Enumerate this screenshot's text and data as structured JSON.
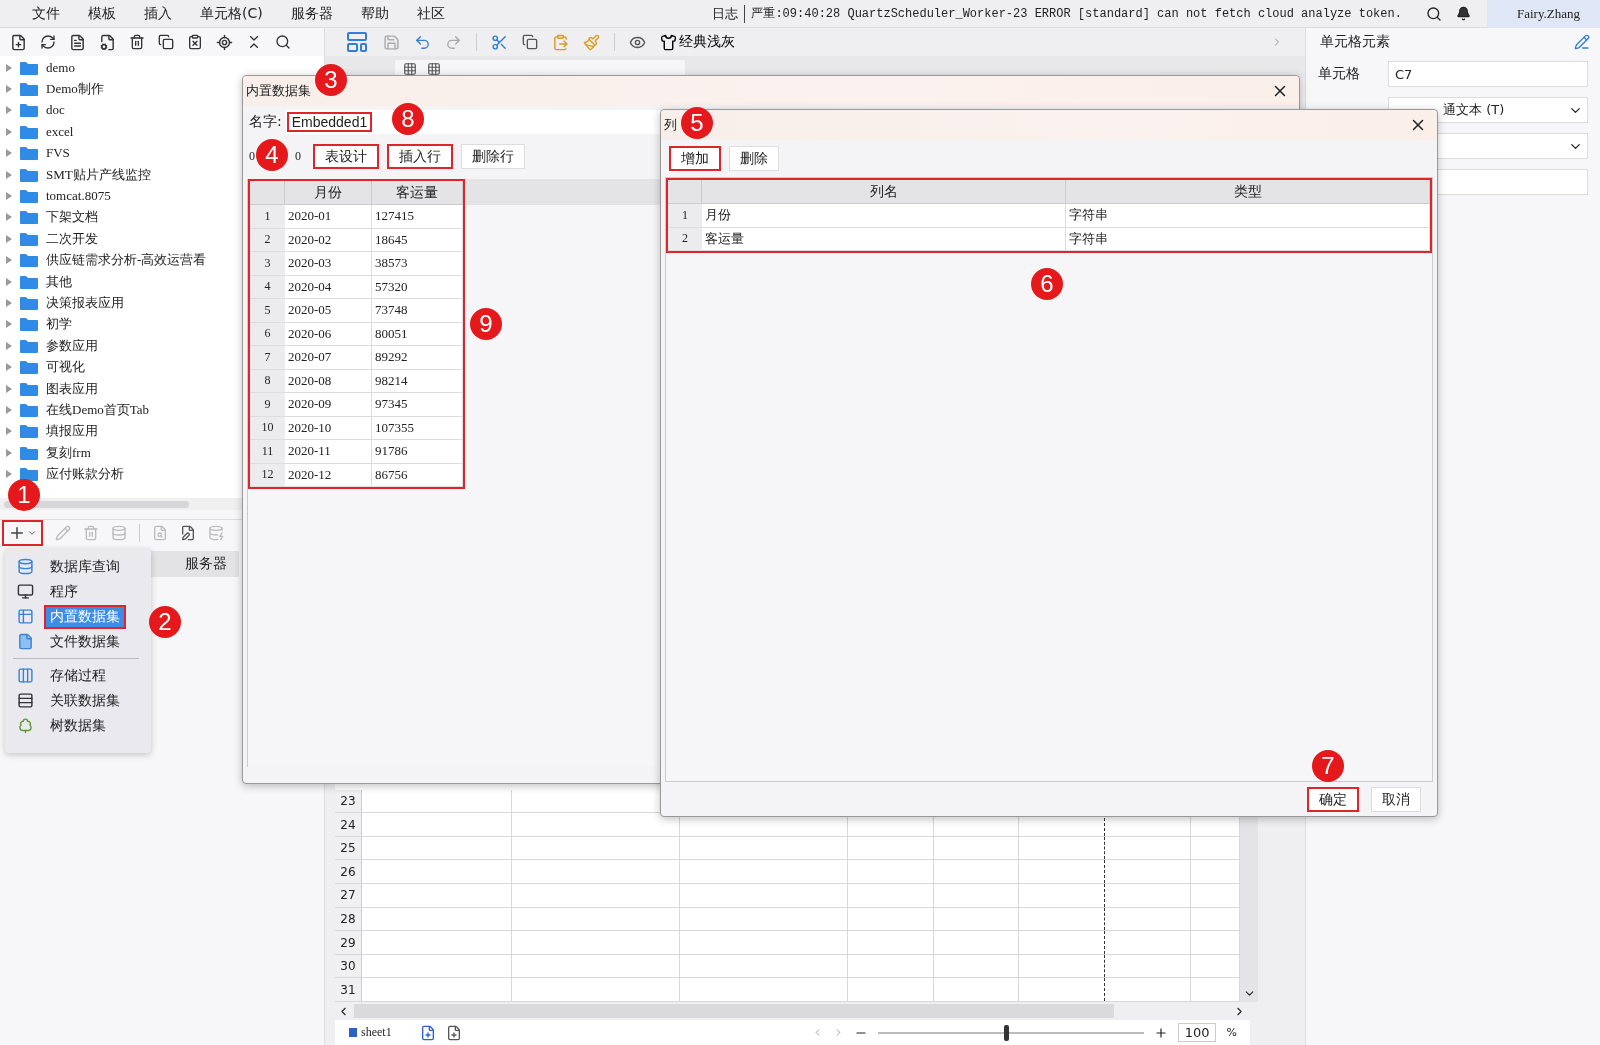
{
  "menu_bar": {
    "menus": [
      "文件",
      "模板",
      "插入",
      "单元格(C)",
      "服务器",
      "帮助",
      "社区"
    ],
    "log_label": "日志",
    "log_message": "严重:09:40:28 QuartzScheduler_Worker-23 ERROR [standard] can not fetch cloud analyze token.",
    "user": "Fairy.Zhang"
  },
  "center_toolbar": {
    "style_button": "经典浅灰"
  },
  "template_tree": {
    "items": [
      {
        "label": "demo"
      },
      {
        "label": "Demo制作"
      },
      {
        "label": "doc"
      },
      {
        "label": "excel"
      },
      {
        "label": "FVS"
      },
      {
        "label": "SMT贴片产线监控"
      },
      {
        "label": "tomcat.8075"
      },
      {
        "label": "下架文档"
      },
      {
        "label": "二次开发"
      },
      {
        "label": "供应链需求分析-高效运营看"
      },
      {
        "label": "其他"
      },
      {
        "label": "决策报表应用"
      },
      {
        "label": "初学"
      },
      {
        "label": "参数应用"
      },
      {
        "label": "可视化"
      },
      {
        "label": "图表应用"
      },
      {
        "label": "在线Demo首页Tab"
      },
      {
        "label": "填报应用"
      },
      {
        "label": "复刻frm"
      },
      {
        "label": "应付账款分析"
      }
    ]
  },
  "dataset_panel": {
    "add_button_highlighted": true,
    "tab": "服务器"
  },
  "dataset_menu": {
    "groups": [
      [
        {
          "label": "数据库查询",
          "kind": "database",
          "selected": false
        },
        {
          "label": "程序",
          "kind": "program",
          "selected": false
        },
        {
          "label": "内置数据集",
          "kind": "embedded",
          "selected": true
        },
        {
          "label": "文件数据集",
          "kind": "file",
          "selected": false
        }
      ],
      [
        {
          "label": "存储过程",
          "kind": "procedure",
          "selected": false
        },
        {
          "label": "关联数据集",
          "kind": "relation",
          "selected": false
        },
        {
          "label": "树数据集",
          "kind": "tree",
          "selected": false
        }
      ]
    ]
  },
  "embedded_dialog": {
    "title": "内置数据集",
    "name_label": "名字:",
    "name_value": "Embedded1",
    "name_highlighted": true,
    "counters": [
      "0",
      "0"
    ],
    "buttons": [
      {
        "label": "表设计",
        "highlighted": true
      },
      {
        "label": "插入行",
        "highlighted": true
      },
      {
        "label": "删除行",
        "highlighted": false
      }
    ],
    "table": {
      "highlighted": true,
      "columns": [
        "月份",
        "客运量"
      ],
      "rows": [
        {
          "index": "1",
          "cells": [
            "2020-01",
            "127415"
          ]
        },
        {
          "index": "2",
          "cells": [
            "2020-02",
            "18645"
          ]
        },
        {
          "index": "3",
          "cells": [
            "2020-03",
            "38573"
          ]
        },
        {
          "index": "4",
          "cells": [
            "2020-04",
            "57320"
          ]
        },
        {
          "index": "5",
          "cells": [
            "2020-05",
            "73748"
          ]
        },
        {
          "index": "6",
          "cells": [
            "2020-06",
            "80051"
          ]
        },
        {
          "index": "7",
          "cells": [
            "2020-07",
            "89292"
          ]
        },
        {
          "index": "8",
          "cells": [
            "2020-08",
            "98214"
          ]
        },
        {
          "index": "9",
          "cells": [
            "2020-09",
            "97345"
          ]
        },
        {
          "index": "10",
          "cells": [
            "2020-10",
            "107355"
          ]
        },
        {
          "index": "11",
          "cells": [
            "2020-11",
            "91786"
          ]
        },
        {
          "index": "12",
          "cells": [
            "2020-12",
            "86756"
          ]
        }
      ]
    }
  },
  "columns_dialog": {
    "title": "列",
    "buttons": [
      {
        "label": "增加",
        "highlighted": true
      },
      {
        "label": "删除",
        "highlighted": false
      }
    ],
    "table": {
      "highlighted": true,
      "columns": [
        "列名",
        "类型"
      ],
      "rows": [
        {
          "index": "1",
          "cells": [
            "月份",
            "字符串"
          ]
        },
        {
          "index": "2",
          "cells": [
            "客运量",
            "字符串"
          ]
        }
      ]
    },
    "footer_buttons": [
      {
        "label": "确定",
        "highlighted": true
      },
      {
        "label": "取消",
        "highlighted": false
      }
    ]
  },
  "right_panel": {
    "title": "单元格元素",
    "cell_label": "单元格",
    "cell_value": "C7",
    "type_value": "通文本 (T)"
  },
  "spreadsheet": {
    "row_numbers": [
      "23",
      "24",
      "25",
      "26",
      "27",
      "28",
      "29",
      "30",
      "31"
    ],
    "sheet_tab": "sheet1",
    "zoom": {
      "level": 0.47
    },
    "zoom_value": "100",
    "zoom_unit": "%"
  },
  "annotations": [
    "1",
    "2",
    "3",
    "4",
    "5",
    "6",
    "7",
    "8",
    "9"
  ]
}
